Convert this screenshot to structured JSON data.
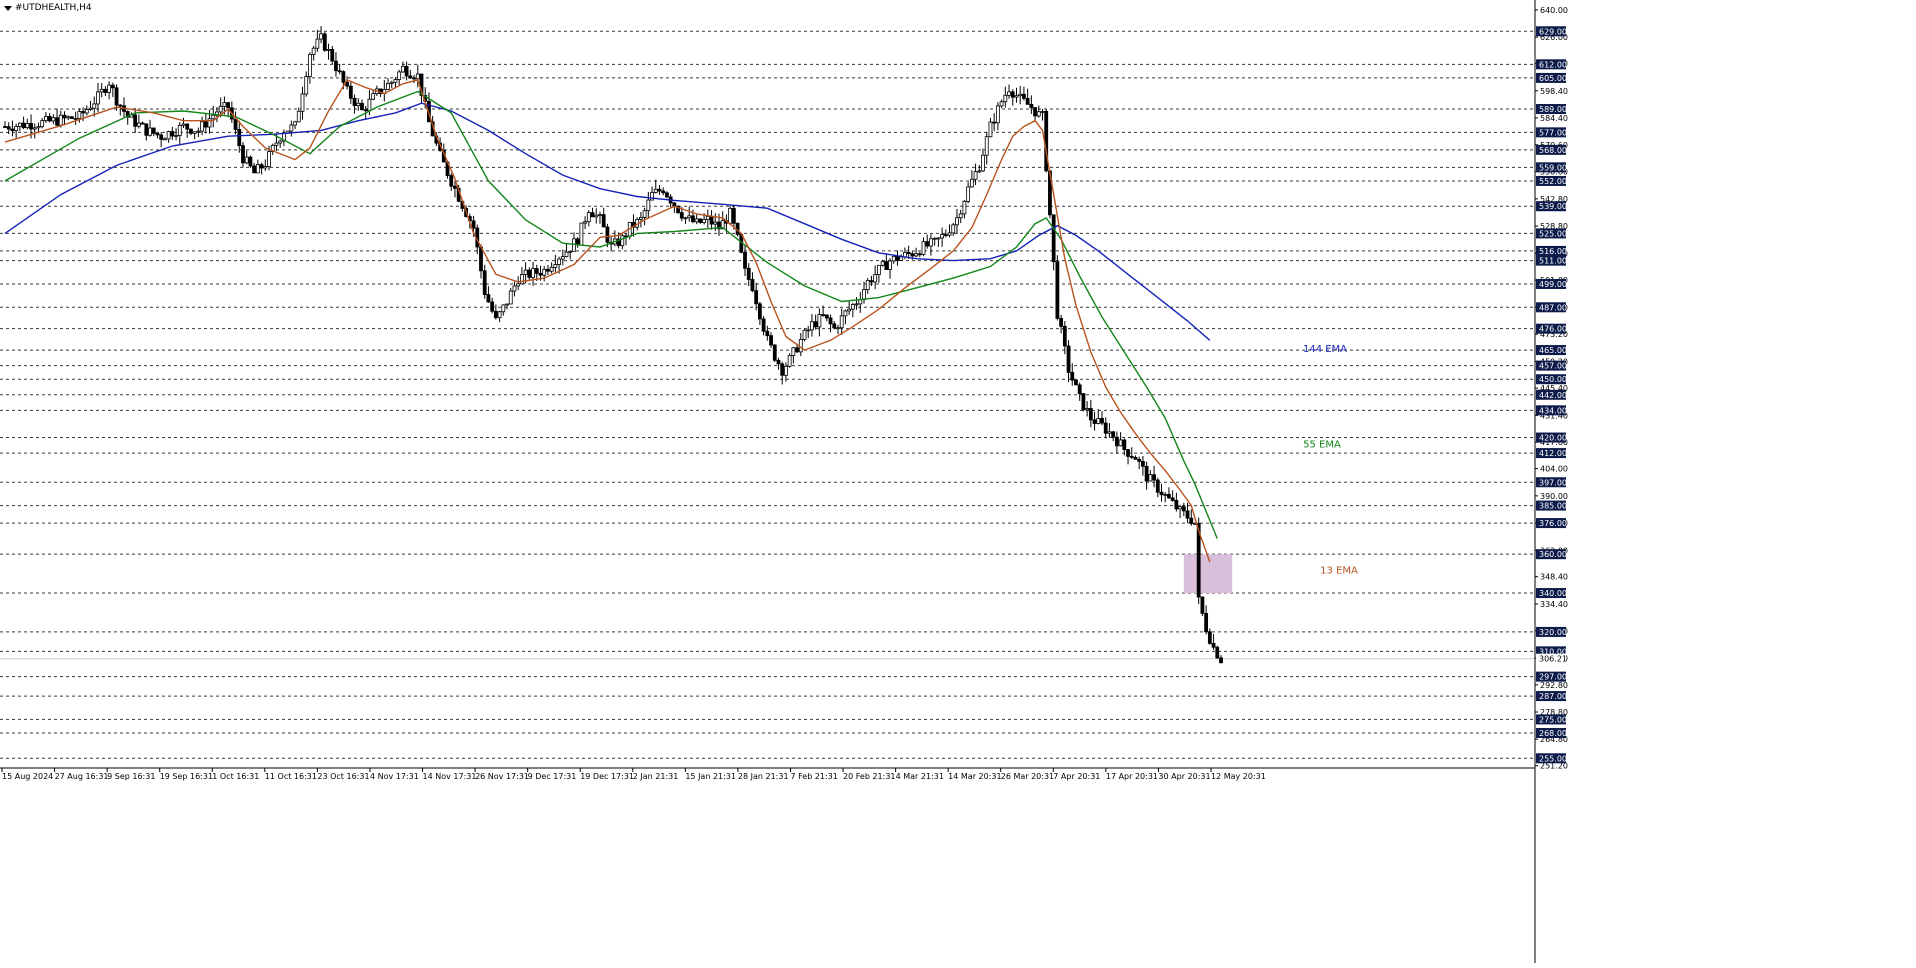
{
  "symbol": "#UTDHEALTH,H4",
  "colors": {
    "bull": "#000000",
    "bear": "#000000",
    "ema13": "#b8541e",
    "ema55": "#13861a",
    "ema144": "#1522b8",
    "badge_bg": "#0c1b4a",
    "zone": "#d8bcd8",
    "grid": "#3a3a3a",
    "current_price": "#c8c8c8"
  },
  "chart_data": {
    "type": "candlestick",
    "symbol": "#UTDHEALTH",
    "timeframe": "H4",
    "ylim": [
      250,
      642
    ],
    "y_ticks": [
      640.0,
      626.0,
      612.4,
      598.4,
      584.4,
      570.6,
      556.8,
      542.8,
      528.8,
      514.8,
      501.0,
      487.0,
      473.2,
      459.2,
      445.4,
      431.4,
      417.6,
      404.0,
      390.0,
      376.0,
      362.0,
      348.4,
      334.4,
      320.6,
      306.6,
      292.8,
      278.8,
      264.8,
      251.2
    ],
    "level_badges": [
      629.0,
      612.0,
      605.0,
      589.0,
      577.0,
      568.0,
      559.0,
      552.0,
      539.0,
      525.0,
      516.0,
      511.0,
      499.0,
      487.0,
      476.0,
      465.0,
      457.0,
      450.0,
      442.0,
      434.0,
      420.0,
      412.0,
      397.0,
      385.0,
      376.0,
      360.0,
      340.0,
      320.0,
      310.0,
      297.0,
      287.0,
      275.0,
      268.0,
      255.0
    ],
    "current_price": 306.21,
    "current_price_label": "306.21",
    "x_labels": [
      "15 Aug 2024",
      "27 Aug 16:31",
      "9 Sep 16:31",
      "19 Sep 16:31",
      "1 Oct 16:31",
      "11 Oct 16:31",
      "23 Oct 16:31",
      "4 Nov 17:31",
      "14 Nov 17:31",
      "26 Nov 17:31",
      "9 Dec 17:31",
      "19 Dec 17:31",
      "2 Jan 21:31",
      "15 Jan 21:31",
      "28 Jan 21:31",
      "7 Feb 21:31",
      "20 Feb 21:31",
      "4 Mar 21:31",
      "14 Mar 20:31",
      "26 Mar 20:31",
      "7 Apr 20:31",
      "17 Apr 20:31",
      "30 Apr 20:31",
      "12 May 20:31"
    ],
    "price_path": [
      [
        0,
        580
      ],
      [
        10,
        582
      ],
      [
        20,
        585
      ],
      [
        25,
        595
      ],
      [
        28,
        603
      ],
      [
        30,
        594
      ],
      [
        33,
        585
      ],
      [
        38,
        578
      ],
      [
        42,
        575
      ],
      [
        48,
        580
      ],
      [
        52,
        578
      ],
      [
        57,
        588
      ],
      [
        60,
        590
      ],
      [
        64,
        564
      ],
      [
        67,
        556
      ],
      [
        70,
        561
      ],
      [
        73,
        572
      ],
      [
        75,
        578
      ],
      [
        78,
        580
      ],
      [
        82,
        618
      ],
      [
        85,
        625
      ],
      [
        88,
        615
      ],
      [
        92,
        598
      ],
      [
        96,
        588
      ],
      [
        100,
        597
      ],
      [
        104,
        603
      ],
      [
        107,
        610
      ],
      [
        111,
        606
      ],
      [
        114,
        582
      ],
      [
        117,
        565
      ],
      [
        120,
        552
      ],
      [
        123,
        540
      ],
      [
        126,
        528
      ],
      [
        129,
        495
      ],
      [
        132,
        480
      ],
      [
        135,
        490
      ],
      [
        138,
        502
      ],
      [
        141,
        504
      ],
      [
        145,
        506
      ],
      [
        148,
        512
      ],
      [
        151,
        516
      ],
      [
        154,
        522
      ],
      [
        157,
        538
      ],
      [
        160,
        532
      ],
      [
        163,
        518
      ],
      [
        166,
        522
      ],
      [
        168,
        528
      ],
      [
        171,
        532
      ],
      [
        174,
        545
      ],
      [
        177,
        548
      ],
      [
        180,
        540
      ],
      [
        183,
        533
      ],
      [
        186,
        530
      ],
      [
        189,
        532
      ],
      [
        192,
        528
      ],
      [
        195,
        535
      ],
      [
        197,
        522
      ],
      [
        199,
        505
      ],
      [
        201,
        498
      ],
      [
        203,
        484
      ],
      [
        205,
        470
      ],
      [
        207,
        462
      ],
      [
        209,
        455
      ],
      [
        211,
        460
      ],
      [
        214,
        470
      ],
      [
        217,
        478
      ],
      [
        220,
        482
      ],
      [
        223,
        476
      ],
      [
        226,
        484
      ],
      [
        229,
        490
      ],
      [
        232,
        500
      ],
      [
        235,
        506
      ],
      [
        238,
        511
      ],
      [
        241,
        513
      ],
      [
        244,
        515
      ],
      [
        247,
        518
      ],
      [
        250,
        520
      ],
      [
        253,
        525
      ],
      [
        256,
        533
      ],
      [
        259,
        548
      ],
      [
        262,
        560
      ],
      [
        265,
        580
      ],
      [
        268,
        593
      ],
      [
        270,
        600
      ],
      [
        273,
        594
      ],
      [
        276,
        590
      ],
      [
        278,
        586
      ],
      [
        279,
        585
      ],
      [
        283,
        484
      ],
      [
        286,
        455
      ],
      [
        289,
        440
      ],
      [
        292,
        430
      ],
      [
        295,
        426
      ],
      [
        298,
        421
      ],
      [
        301,
        414
      ],
      [
        304,
        410
      ],
      [
        307,
        400
      ],
      [
        310,
        394
      ],
      [
        313,
        388
      ],
      [
        316,
        382
      ],
      [
        319,
        378
      ],
      [
        320,
        376
      ],
      [
        321,
        336
      ],
      [
        323,
        322
      ],
      [
        325,
        312
      ],
      [
        327,
        306
      ]
    ],
    "ema13_path": [
      [
        0,
        572
      ],
      [
        16,
        581
      ],
      [
        30,
        590
      ],
      [
        40,
        587
      ],
      [
        48,
        583
      ],
      [
        56,
        583
      ],
      [
        60,
        589
      ],
      [
        64,
        580
      ],
      [
        70,
        569
      ],
      [
        78,
        563
      ],
      [
        82,
        569
      ],
      [
        87,
        588
      ],
      [
        92,
        604
      ],
      [
        97,
        600
      ],
      [
        102,
        597
      ],
      [
        107,
        602
      ],
      [
        111,
        604
      ],
      [
        116,
        575
      ],
      [
        121,
        553
      ],
      [
        126,
        525
      ],
      [
        132,
        504
      ],
      [
        138,
        500
      ],
      [
        145,
        502
      ],
      [
        153,
        509
      ],
      [
        160,
        523
      ],
      [
        165,
        524
      ],
      [
        172,
        532
      ],
      [
        180,
        539
      ],
      [
        186,
        535
      ],
      [
        193,
        533
      ],
      [
        198,
        525
      ],
      [
        202,
        510
      ],
      [
        206,
        490
      ],
      [
        210,
        472
      ],
      [
        215,
        465
      ],
      [
        222,
        470
      ],
      [
        228,
        477
      ],
      [
        235,
        486
      ],
      [
        242,
        497
      ],
      [
        249,
        507
      ],
      [
        255,
        516
      ],
      [
        260,
        528
      ],
      [
        264,
        545
      ],
      [
        268,
        563
      ],
      [
        271,
        575
      ],
      [
        274,
        580
      ],
      [
        277,
        583
      ],
      [
        279,
        578
      ],
      [
        282,
        545
      ],
      [
        285,
        512
      ],
      [
        288,
        488
      ],
      [
        292,
        464
      ],
      [
        296,
        446
      ],
      [
        300,
        433
      ],
      [
        304,
        422
      ],
      [
        308,
        412
      ],
      [
        312,
        403
      ],
      [
        316,
        393
      ],
      [
        319,
        385
      ],
      [
        321,
        372
      ],
      [
        324,
        356
      ]
    ],
    "ema55_path": [
      [
        0,
        552
      ],
      [
        20,
        574
      ],
      [
        35,
        587
      ],
      [
        48,
        588
      ],
      [
        62,
        585
      ],
      [
        72,
        576
      ],
      [
        82,
        566
      ],
      [
        90,
        580
      ],
      [
        100,
        590
      ],
      [
        111,
        598
      ],
      [
        120,
        587
      ],
      [
        130,
        552
      ],
      [
        140,
        532
      ],
      [
        150,
        520
      ],
      [
        160,
        518
      ],
      [
        170,
        525
      ],
      [
        180,
        526
      ],
      [
        193,
        528
      ],
      [
        205,
        510
      ],
      [
        215,
        498
      ],
      [
        225,
        490
      ],
      [
        235,
        492
      ],
      [
        245,
        497
      ],
      [
        255,
        502
      ],
      [
        265,
        508
      ],
      [
        272,
        518
      ],
      [
        277,
        530
      ],
      [
        280,
        533
      ],
      [
        284,
        522
      ],
      [
        289,
        503
      ],
      [
        295,
        482
      ],
      [
        301,
        464
      ],
      [
        307,
        446
      ],
      [
        312,
        430
      ],
      [
        317,
        408
      ],
      [
        320,
        396
      ],
      [
        323,
        382
      ],
      [
        326,
        368
      ]
    ],
    "ema144_path": [
      [
        0,
        525
      ],
      [
        15,
        545
      ],
      [
        30,
        560
      ],
      [
        45,
        570
      ],
      [
        60,
        575
      ],
      [
        72,
        576
      ],
      [
        85,
        578
      ],
      [
        95,
        583
      ],
      [
        105,
        587
      ],
      [
        112,
        592
      ],
      [
        120,
        588
      ],
      [
        130,
        578
      ],
      [
        140,
        566
      ],
      [
        150,
        555
      ],
      [
        160,
        548
      ],
      [
        170,
        544
      ],
      [
        180,
        542
      ],
      [
        193,
        540
      ],
      [
        205,
        538
      ],
      [
        215,
        530
      ],
      [
        225,
        522
      ],
      [
        235,
        515
      ],
      [
        245,
        512
      ],
      [
        255,
        511
      ],
      [
        265,
        512
      ],
      [
        272,
        516
      ],
      [
        278,
        524
      ],
      [
        283,
        529
      ],
      [
        288,
        524
      ],
      [
        294,
        516
      ],
      [
        302,
        504
      ],
      [
        310,
        492
      ],
      [
        318,
        480
      ],
      [
        324,
        470
      ]
    ],
    "buy_zone": {
      "from_index": 317,
      "to_index": 330,
      "low": 340,
      "high": 360
    },
    "annotations": [
      {
        "text": "144 EMA",
        "price": 466,
        "color_key": "ema144"
      },
      {
        "text": "55 EMA",
        "price": 417,
        "color_key": "ema55"
      },
      {
        "text": "13 EMA",
        "price": 352,
        "color_key": "ema13"
      }
    ],
    "grid": "horizontal dashed at level badges",
    "legend": "inline labels right"
  }
}
